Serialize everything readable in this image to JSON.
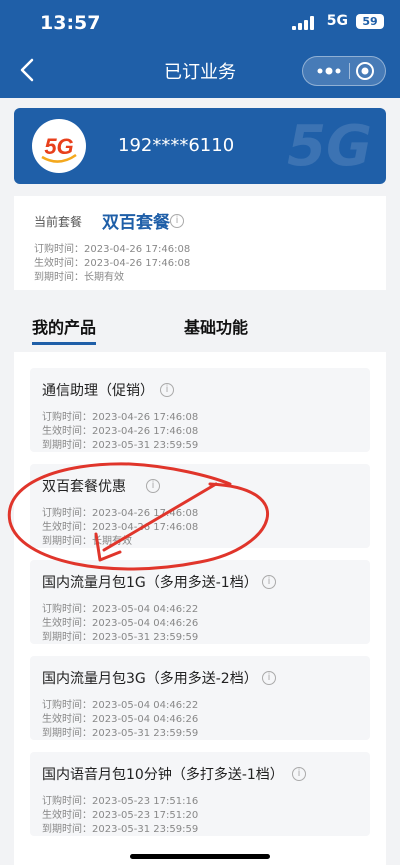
{
  "status": {
    "time": "13:57",
    "network": "5G",
    "battery": "59"
  },
  "nav": {
    "title": "已订业务"
  },
  "account": {
    "phone": "192****6110",
    "logo_text": "5G",
    "watermark": "5G"
  },
  "current_package": {
    "label": "当前套餐",
    "name": "双百套餐",
    "info_icon": "i",
    "lines": [
      "订购时间：2023-04-26 17:46:08",
      "生效时间：2023-04-26 17:46:08",
      "到期时间：长期有效"
    ]
  },
  "tabs": [
    {
      "label": "我的产品",
      "active": true
    },
    {
      "label": "基础功能",
      "active": false
    }
  ],
  "products": [
    {
      "name": "通信助理（促销）",
      "lines": [
        "订购时间：2023-04-26 17:46:08",
        "生效时间：2023-04-26 17:46:08",
        "到期时间：2023-05-31 23:59:59"
      ]
    },
    {
      "name": "双百套餐优惠",
      "lines": [
        "订购时间：2023-04-26 17:46:08",
        "生效时间：2023-04-26 17:46:08",
        "到期时间：长期有效"
      ]
    },
    {
      "name": "国内流量月包1G（多用多送-1档）",
      "lines": [
        "订购时间：2023-05-04 04:46:22",
        "生效时间：2023-05-04 04:46:26",
        "到期时间：2023-05-31 23:59:59"
      ]
    },
    {
      "name": "国内流量月包3G（多用多送-2档）",
      "lines": [
        "订购时间：2023-05-04 04:46:22",
        "生效时间：2023-05-04 04:46:26",
        "到期时间：2023-05-31 23:59:59"
      ]
    },
    {
      "name": "国内语音月包10分钟（多打多送-1档）",
      "lines": [
        "订购时间：2023-05-23 17:51:16",
        "生效时间：2023-05-23 17:51:20",
        "到期时间：2023-05-31 23:59:59"
      ]
    }
  ],
  "colors": {
    "brand": "#1f5fa8",
    "annotation": "#e0352b"
  }
}
